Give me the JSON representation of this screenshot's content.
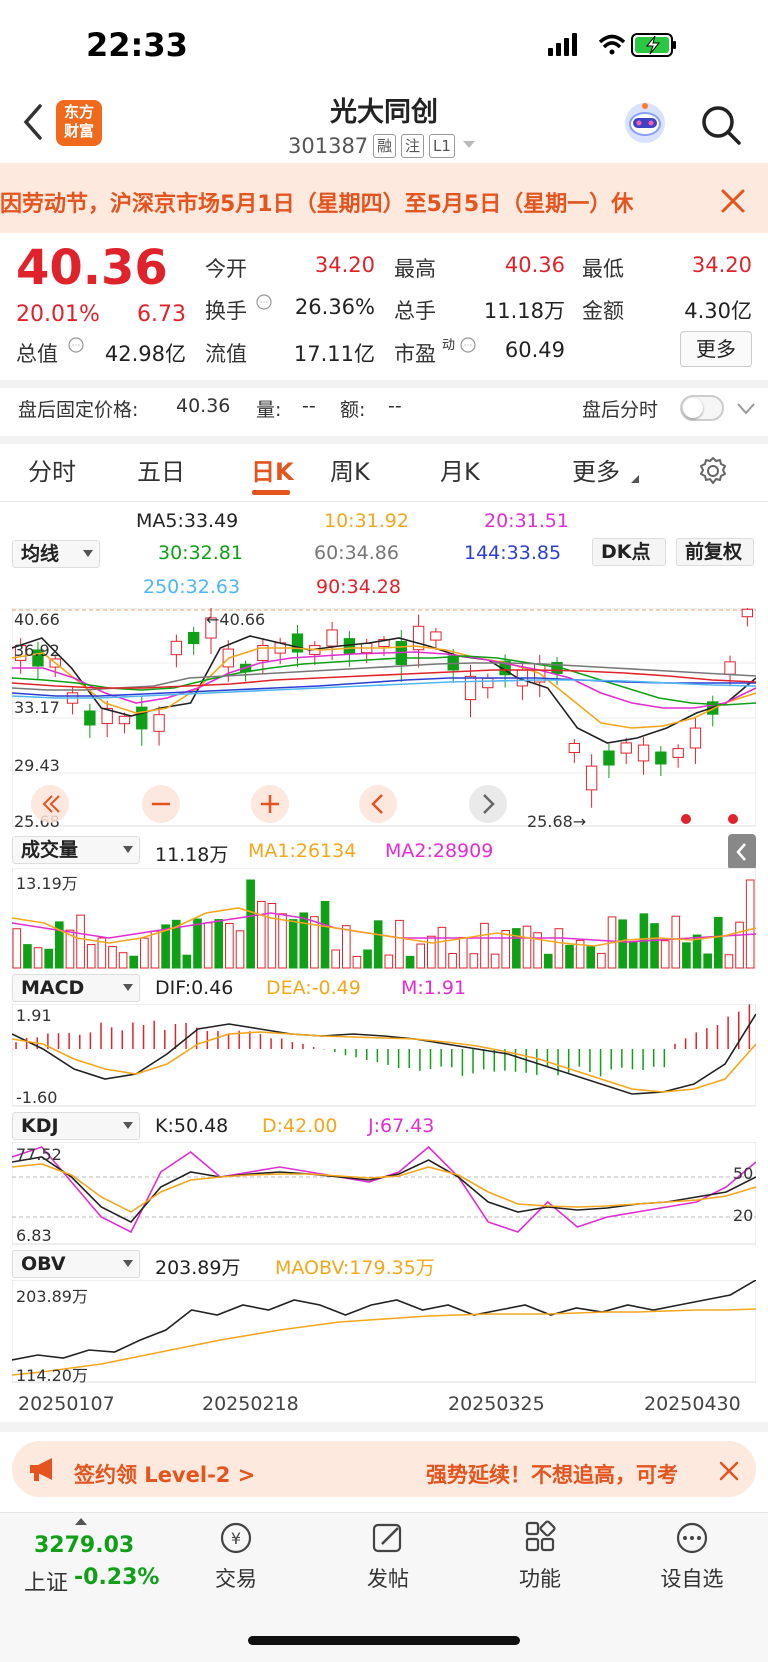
{
  "status_bar": {
    "time": "22:33"
  },
  "header": {
    "title": "光大同创",
    "code": "301387",
    "tags": [
      "融",
      "注",
      "L1"
    ],
    "logo_line1": "东方",
    "logo_line2": "财富"
  },
  "notice": {
    "text": "因劳动节，沪深京市场5月1日（星期四）至5月5日（星期一）休"
  },
  "quote": {
    "price": "40.36",
    "change_pct": "20.01%",
    "change": "6.73",
    "open_label": "今开",
    "open": "34.20",
    "high_label": "最高",
    "high": "40.36",
    "low_label": "最低",
    "low": "34.20",
    "turnover_label": "换手",
    "turnover": "26.36%",
    "volume_label": "总手",
    "volume": "11.18万",
    "amount_label": "金额",
    "amount": "4.30亿",
    "mktcap_label": "总值",
    "mktcap": "42.98亿",
    "float_label": "流值",
    "float": "17.11亿",
    "pe_label": "市盈",
    "pe_sup": "动",
    "pe": "60.49",
    "more_label": "更多"
  },
  "after_hours": {
    "fixed_price_label": "盘后固定价格:",
    "fixed_price": "40.36",
    "qty_label": "量:",
    "qty": "--",
    "amt_label": "额:",
    "amt": "--",
    "intraday_label": "盘后分时"
  },
  "tabs": [
    "分时",
    "五日",
    "日K",
    "周K",
    "月K",
    "更多"
  ],
  "ma_legend": {
    "selector": "均线",
    "ma5": "MA5:33.49",
    "ma10": "10:31.92",
    "ma20": "20:31.51",
    "ma30": "30:32.81",
    "ma60": "60:34.86",
    "ma144": "144:33.85",
    "ma250": "250:32.63",
    "ma90": "90:34.28",
    "dk_label": "DK点",
    "adjust_label": "前复权"
  },
  "kline": {
    "max_label": "40.66",
    "min_label": "25.68",
    "left_top": "40.66",
    "left_mid1": "36.92",
    "left_mid2": "33.17",
    "left_low": "29.43",
    "left_bottom": "25.68",
    "high_marker": "←40.66",
    "low_marker": "25.68→"
  },
  "volume": {
    "selector": "成交量",
    "value": "11.18万",
    "ma1": "MA1:26134",
    "ma2": "MA2:28909",
    "max": "13.19万"
  },
  "macd": {
    "selector": "MACD",
    "dif": "DIF:0.46",
    "dea": "DEA:-0.49",
    "m": "M:1.91",
    "top": "1.91",
    "bottom": "-1.60"
  },
  "kdj": {
    "selector": "KDJ",
    "k": "K:50.48",
    "d": "D:42.00",
    "j": "J:67.43",
    "top": "77.52",
    "bottom": "6.83",
    "r50": "50",
    "r20": "20"
  },
  "obv": {
    "selector": "OBV",
    "obv": "203.89万",
    "maobv": "MAOBV:179.35万",
    "top": "203.89万",
    "bottom": "114.20万"
  },
  "dates": [
    "20250107",
    "20250218",
    "20250325",
    "20250430"
  ],
  "promo": {
    "left": "签约领 Level-2 >",
    "right": "强势延续！不想追高，可考"
  },
  "bottom_nav": {
    "index_value": "3279.03",
    "index_name": "上证",
    "index_change": "-0.23%",
    "items": [
      "交易",
      "发帖",
      "功能",
      "设自选"
    ]
  },
  "colors": {
    "up": "#e0232b",
    "down": "#10a017",
    "accent": "#e4541f"
  }
}
